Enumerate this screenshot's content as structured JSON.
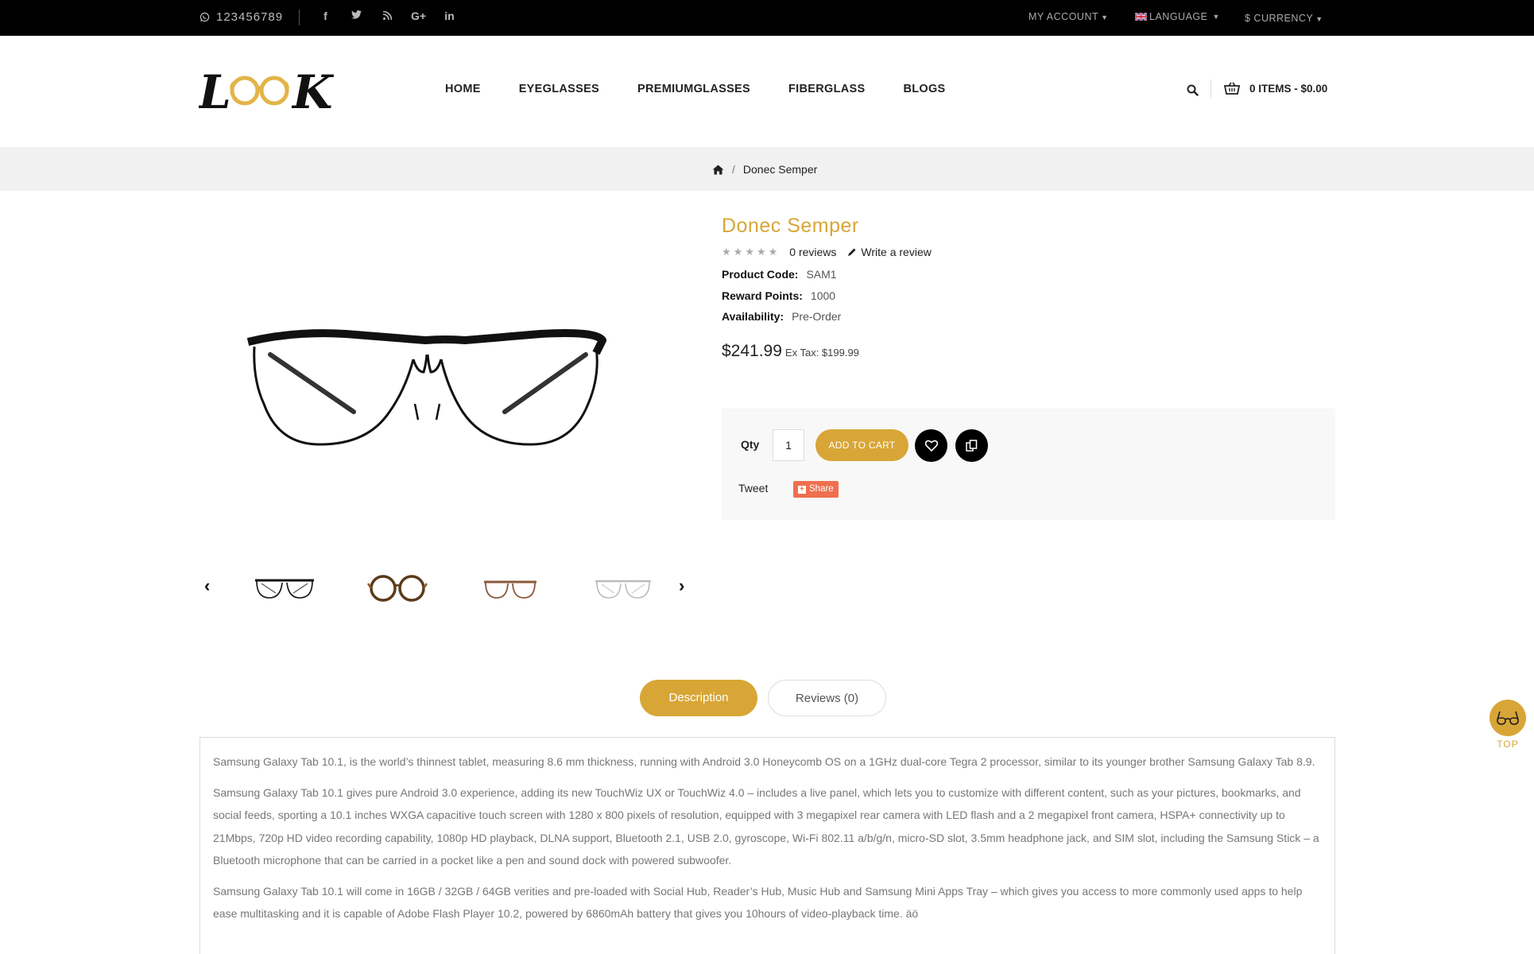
{
  "topbar": {
    "phone": "123456789",
    "social_icons": [
      "facebook-icon",
      "twitter-icon",
      "rss-icon",
      "google-plus-icon",
      "linkedin-icon"
    ],
    "my_account": "MY ACCOUNT",
    "language": "LANGUAGE",
    "currency": "$ CURRENCY"
  },
  "header": {
    "logo_text": "LOOK",
    "nav": [
      "HOME",
      "EYEGLASSES",
      "PREMIUMGLASSES",
      "FIBERGLASS",
      "BLOGS"
    ],
    "cart_label": "0 ITEMS - $0.00"
  },
  "breadcrumb": {
    "current": "Donec Semper"
  },
  "product": {
    "name": "Donec Semper",
    "reviews": "0 reviews",
    "write_review": "Write a review",
    "rating": 0,
    "code_label": "Product Code:",
    "code": "SAM1",
    "reward_label": "Reward Points:",
    "reward": "1000",
    "availability_label": "Availability:",
    "availability": "Pre-Order",
    "price": "$241.99",
    "ex_tax": "Ex Tax: $199.99",
    "qty_label": "Qty",
    "qty_value": "1",
    "add_to_cart": "ADD TO CART",
    "tweet": "Tweet",
    "share": "Share"
  },
  "tabs": {
    "description": "Description",
    "reviews": "Reviews (0)"
  },
  "description": [
    "Samsung Galaxy Tab 10.1, is the world’s thinnest tablet, measuring 8.6 mm thickness, running with Android 3.0 Honeycomb OS on a 1GHz dual-core Tegra 2 processor, similar to its younger brother Samsung Galaxy Tab 8.9.",
    "Samsung Galaxy Tab 10.1 gives pure Android 3.0 experience, adding its new TouchWiz UX or TouchWiz 4.0 – includes a live panel, which lets you to customize with different content, such as your pictures, bookmarks, and social feeds, sporting a 10.1 inches WXGA capacitive touch screen with 1280 x 800 pixels of resolution, equipped with 3 megapixel rear camera with LED flash and a 2 megapixel front camera, HSPA+ connectivity up to 21Mbps, 720p HD video recording capability, 1080p HD playback, DLNA support, Bluetooth 2.1, USB 2.0, gyroscope, Wi-Fi 802.11 a/b/g/n, micro-SD slot, 3.5mm headphone jack, and SIM slot, including the Samsung Stick – a Bluetooth microphone that can be carried in a pocket like a pen and sound dock with powered subwoofer.",
    "Samsung Galaxy Tab 10.1 will come in 16GB / 32GB / 64GB verities and pre-loaded with Social Hub, Reader’s Hub, Music Hub and Samsung Mini Apps Tray – which gives you access to more commonly used apps to help ease multitasking and it is capable of Adobe Flash Player 10.2, powered by 6860mAh battery that gives you 10hours of video-playback time. äö"
  ],
  "back_to_top": "TOP",
  "colors": {
    "accent": "#d8a636",
    "topbar": "#000000",
    "crumb_bg": "#f1f1f1"
  }
}
